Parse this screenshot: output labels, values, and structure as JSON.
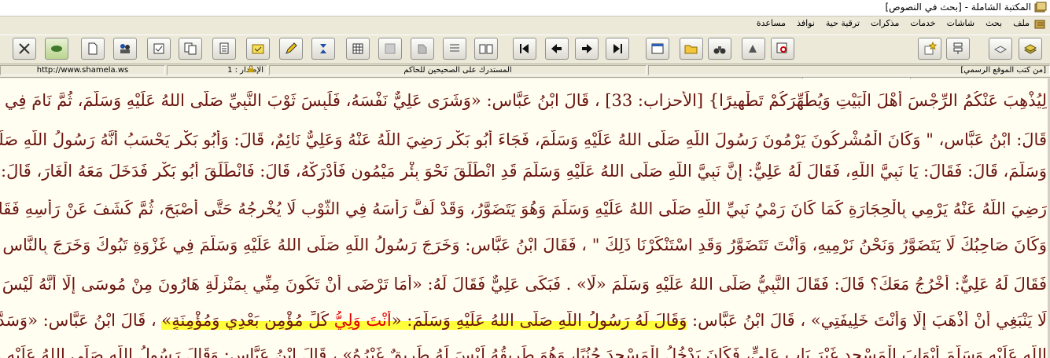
{
  "window": {
    "title": "المكتبة الشاملة - [بحث في النصوص]"
  },
  "menu": {
    "items": [
      "ملف",
      "بحث",
      "شاشات",
      "خدمات",
      "مذكرات",
      "ترقية حية",
      "نوافذ",
      "مساعدة"
    ]
  },
  "toolbar": {
    "buttons_right": [
      "book-icon",
      "books-icon"
    ],
    "buttons_main": [
      "tools-icon",
      "link-icon",
      "blank-page-icon",
      "people-icon",
      "check-icon",
      "copy-icon",
      "paste-icon",
      "folder-icon",
      "pencil-icon",
      "layers-icon",
      "grid-icon",
      "gray-icon",
      "list-icon",
      "open-book-icon",
      "first-icon",
      "prev-icon",
      "next-icon",
      "last-icon",
      "window-icon",
      "open-folder-icon",
      "binoculars-icon",
      "search-tool-icon",
      "zoom-icon"
    ],
    "buttons_left": [
      "new-star-icon",
      "tree-icon"
    ]
  },
  "status": {
    "website": "http://www.shamela.ws",
    "version": "الإصدار : 1",
    "book": "المستدرك على الصحيحين للحاكم",
    "source": "[من كتب الموقع الرسمي]"
  },
  "content": {
    "lines": [
      "لِيُذْهِبَ عَنْكُمُ الرِّجْسَ أَهْلَ الْبَيْتِ وَيُطَهِّرَكُمْ تَطْهِيرًا} [الأحزاب: 33] ، قَالَ ابْنُ عَبَّاسٍ: «وَشَرَى عَلِيٌّ نَفْسَهُ، فَلَبِسَ ثَوْبَ النَّبِيِّ صَلَّى اللهُ عَلَيْهِ وَسَلَّمَ، ثُمَّ نَامَ فِي مَكَانِهِ» ،",
      "قَالَ: ابْنُ عَبَّاسٍ، \" وَكَانَ الْمُشْرِكُونَ يَرْمُونَ رَسُولَ اللَّهِ صَلَّى اللهُ عَلَيْهِ وَسَلَّمَ، فَجَاءَ أَبُو بَكْرٍ رَضِيَ اللَّهُ عَنْهُ وَعَلِيٌّ نَائِمٌ، قَالَ: وَأَبُو بَكْرٍ يَحْسَبُ أَنَّهُ رَسُولُ اللَّهِ صَلَّى اللهُ عَلَيْهِ",
      "وَسَلَّمَ، قَالَ: فَقَالَ: يَا نَبِيَّ اللَّهِ، فَقَالَ لَهُ عَلِيٌّ: إِنَّ نَبِيَّ اللَّهِ صَلَّى اللهُ عَلَيْهِ وَسَلَّمَ قَدِ انْطَلَقَ نَحْوَ بِئْرِ مَيْمُونٍ فَأَدْرَكْهُ، قَالَ: فَانْطَلَقَ أَبُو بَكْرٍ فَدَخَلَ مَعَهُ الْغَارَ، قَالَ: وَجَعَلَ عَلِيٌّ",
      "رَضِيَ اللَّهُ عَنْهُ يَرْمِي بِالْحِجَارَةِ كَمَا كَانَ رَمْيُ نَبِيِّ اللَّهِ صَلَّى اللهُ عَلَيْهِ وَسَلَّمَ وَهُوَ يَتَضَوَّرُ، وَقَدْ لَفَّ رَأْسَهُ فِي الثَّوْبِ لَا يُخْرِجُهُ حَتَّى أَصْبَحَ، ثُمَّ كَشَفَ عَنْ رَأْسِهِ فَقَالُوا: إِنَّكَ لَلَئِيمٌ",
      "وَكَانَ صَاحِبُكَ لَا يَتَضَوَّرُ وَنَحْنُ نَرْمِيهِ، وَأَنْتَ تَتَضَوَّرُ وَقَدِ اسْتَنْكَرْنَا ذَلِكَ \" ، فَقَالَ ابْنُ عَبَّاسٍ: وَخَرَجَ رَسُولُ اللَّهِ صَلَّى اللهُ عَلَيْهِ وَسَلَّمَ فِي غَزْوَةِ تَبُوكَ وَخَرَجَ بِالنَّاسِ مَعَهُ، قَالَ:",
      "فَقَالَ لَهُ عَلِيٌّ: أَخْرُجُ مَعَكَ؟ قَالَ: فَقَالَ النَّبِيُّ صَلَّى اللهُ عَلَيْهِ وَسَلَّمَ «لَا» . فَبَكَى عَلِيٌّ فَقَالَ لَهُ: «أَمَا تَرْضَى أَنْ تَكُونَ مِنِّي بِمَنْزِلَةِ هَارُونَ مِنْ مُوسَى إِلَّا أَنَّهُ لَيْسَ بَعْدِي نَبِيٌّ،",
      "إِلَّا أَنَّهُ لَا يَنْبَغِي أَنْ أَذْهَبَ إِلَّا وَأَنْتَ خَلِيفَتِي» ، قَالَ ابْنُ عَبَّاسٍ:",
      "اللَّهِ عَلَيْهِ وَسَلَّمَ أَبْوَابَ الْمَسْجِدِ غَيْرَ بَابِ عَلِيٍّ، فَكَانَ يَدْخُلُ الْمَسْجِدَ جُنُبًا، وَهُوَ طَرِيقُهُ لَيْسَ لَهُ طَرِيقٌ غَيْرُهُ» ، قَالَ ابْنُ عَبَّاسٍ: وَقَالَ رَسُولُ اللَّهِ صَلَّى اللهُ عَلَيْهِ وَسَلَّمَ: «مَنْ"
    ],
    "line7": {
      "pre": "لَا يَنْبَغِي أَنْ أَذْهَبَ إِلَّا وَأَنْتَ خَلِيفَتِي» ، قَالَ ابْنُ عَبَّاسٍ: ",
      "hl_pre": "وَقَالَ لَهُ رَسُولُ اللَّهِ صَلَّى اللهُ عَلَيْهِ وَسَلَّمَ: «",
      "hl_red": "أَنْتَ وَلِيُّ",
      "hl_post": " كُلِّ مُؤْمِنٍ بَعْدِي وَمُؤْمِنَةٍ»",
      "post": " ، قَالَ ابْنُ عَبَّاسٍ: «وَسَدَّ رَسُولُ اللَّهِ صَلَّى"
    }
  }
}
